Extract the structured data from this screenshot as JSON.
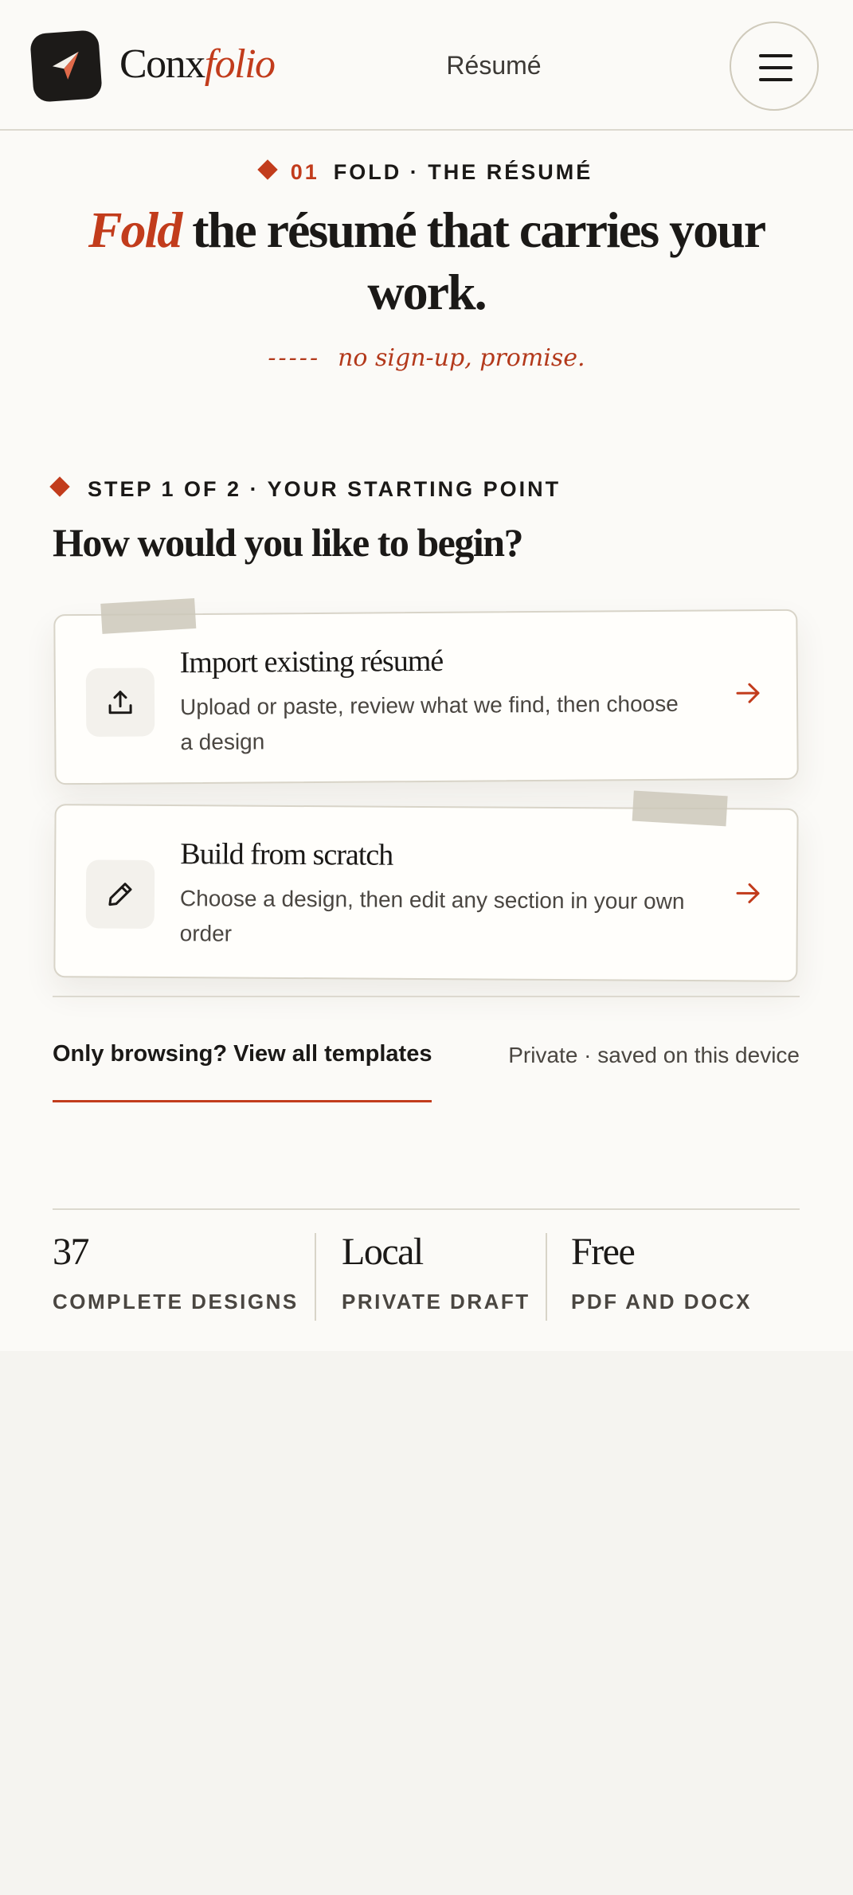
{
  "header": {
    "brand_prefix": "Conx",
    "brand_accent": "folio",
    "nav_label": "Résumé",
    "logo_icon": "paper-plane-icon",
    "menu_icon": "hamburger-menu-icon"
  },
  "hero": {
    "eyebrow_number": "01",
    "eyebrow_text": "FOLD · THE RÉSUMÉ",
    "title_accent": "Fold",
    "title_rest": " the résumé that carries your work.",
    "note_dashes": "-----",
    "note_text": "no sign-up, promise."
  },
  "step": {
    "eyebrow": "STEP 1 OF 2 · YOUR STARTING POINT",
    "title": "How would you like to begin?"
  },
  "options": [
    {
      "title": "Import existing résumé",
      "description": "Upload or paste, review what we find, then choose a design",
      "icon": "upload-icon"
    },
    {
      "title": "Build from scratch",
      "description": "Choose a design, then edit any section in your own order",
      "icon": "pencil-icon"
    }
  ],
  "footer": {
    "browse_link": "Only browsing? View all templates",
    "private_note": "Private · saved on this device"
  },
  "stats": [
    {
      "value": "37",
      "label": "COMPLETE DESIGNS"
    },
    {
      "value": "Local",
      "label": "PRIVATE DRAFT"
    },
    {
      "value": "Free",
      "label": "PDF AND DOCX"
    }
  ],
  "colors": {
    "accent": "#c23c1c",
    "background": "#fbfaf7",
    "ink": "#1b1917"
  }
}
